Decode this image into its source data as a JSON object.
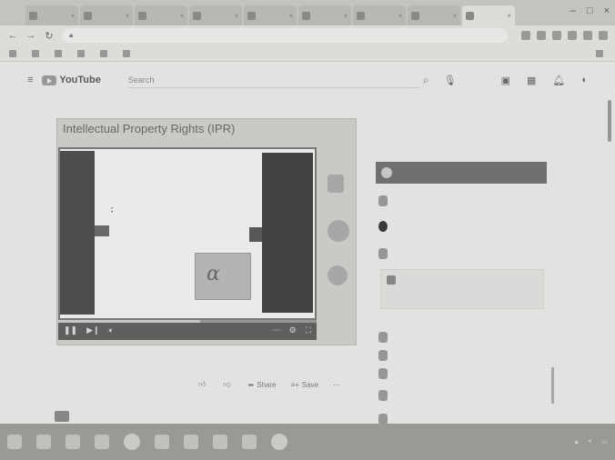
{
  "browser": {
    "tabs": [
      "",
      "",
      "",
      "",
      "",
      "",
      "",
      "",
      ""
    ],
    "active_tab_index": 8,
    "url": "",
    "bookmarks": [
      "",
      "",
      "",
      "",
      "",
      "",
      ""
    ]
  },
  "youtube": {
    "logo_text": "YouTube",
    "search_placeholder": "Search"
  },
  "video": {
    "brand": "",
    "slide_title": "Intellectual Property Rights (IPR)",
    "slide_bullets": [
      "",
      "",
      ""
    ],
    "title": "",
    "views": "",
    "actions": {
      "like": "",
      "dislike": "",
      "share": "Share",
      "save": "Save"
    },
    "progress_fraction": 0.55,
    "caption": ""
  },
  "channel": {
    "name": ""
  },
  "playlist": {
    "header": "",
    "active_item": "",
    "items": [
      "",
      "",
      ""
    ],
    "card_text": "",
    "card_link": "",
    "more_items": [
      "",
      "",
      "",
      "",
      ""
    ]
  },
  "colors": {
    "page_bg": "#ebebea",
    "player_controls": "#5c5c5a",
    "playlist_active": "#6f6f6c"
  }
}
